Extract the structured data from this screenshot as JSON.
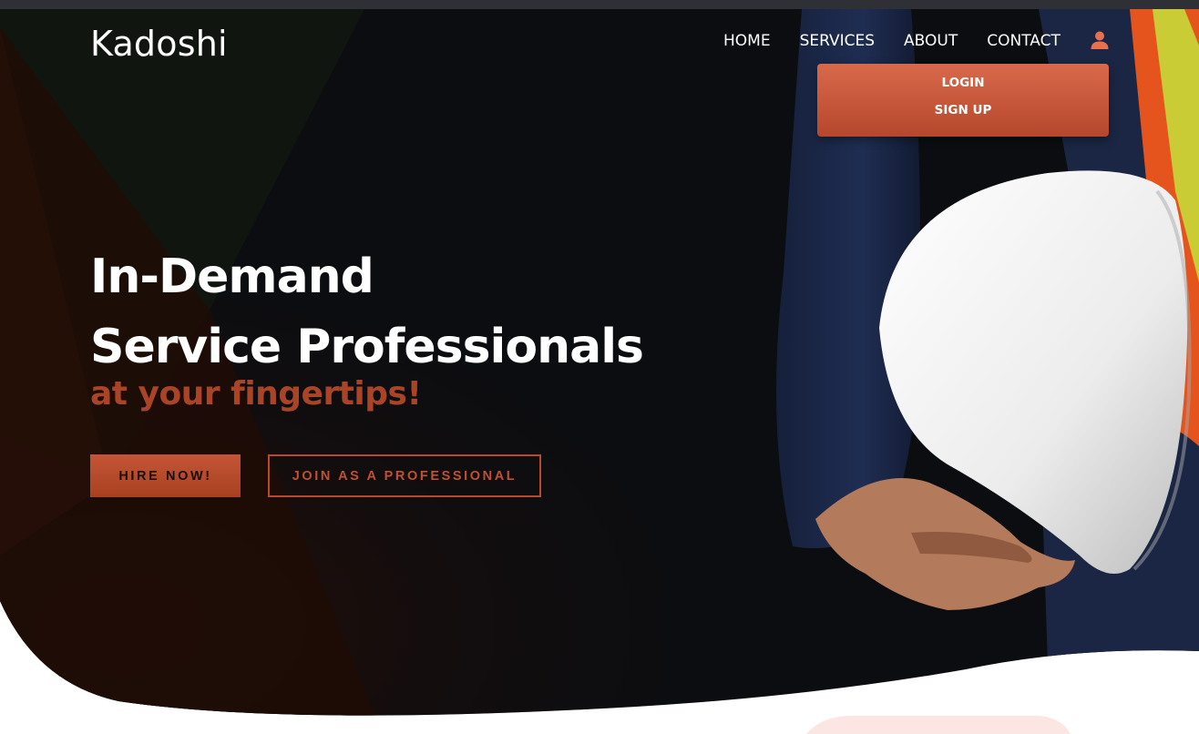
{
  "brand": {
    "name": "Kadoshi"
  },
  "nav": {
    "items": [
      "HOME",
      "SERVICES",
      "ABOUT",
      "CONTACT"
    ],
    "user_icon": "user-icon"
  },
  "account_menu": {
    "items": [
      "LOGIN",
      "SIGN UP"
    ]
  },
  "hero": {
    "headline_line1": "In-Demand",
    "headline_line2": "Service Professionals",
    "tagline": "at your fingertips!",
    "primary_cta": "HIRE NOW!",
    "secondary_cta": "JOIN AS A PROFESSIONAL",
    "image_description_icon": "worker-holding-hard-hat"
  },
  "colors": {
    "accent": "#b5472c",
    "accent_light": "#d9694b",
    "hero_dark": "#0b0d10",
    "text_light": "#ffffff"
  }
}
